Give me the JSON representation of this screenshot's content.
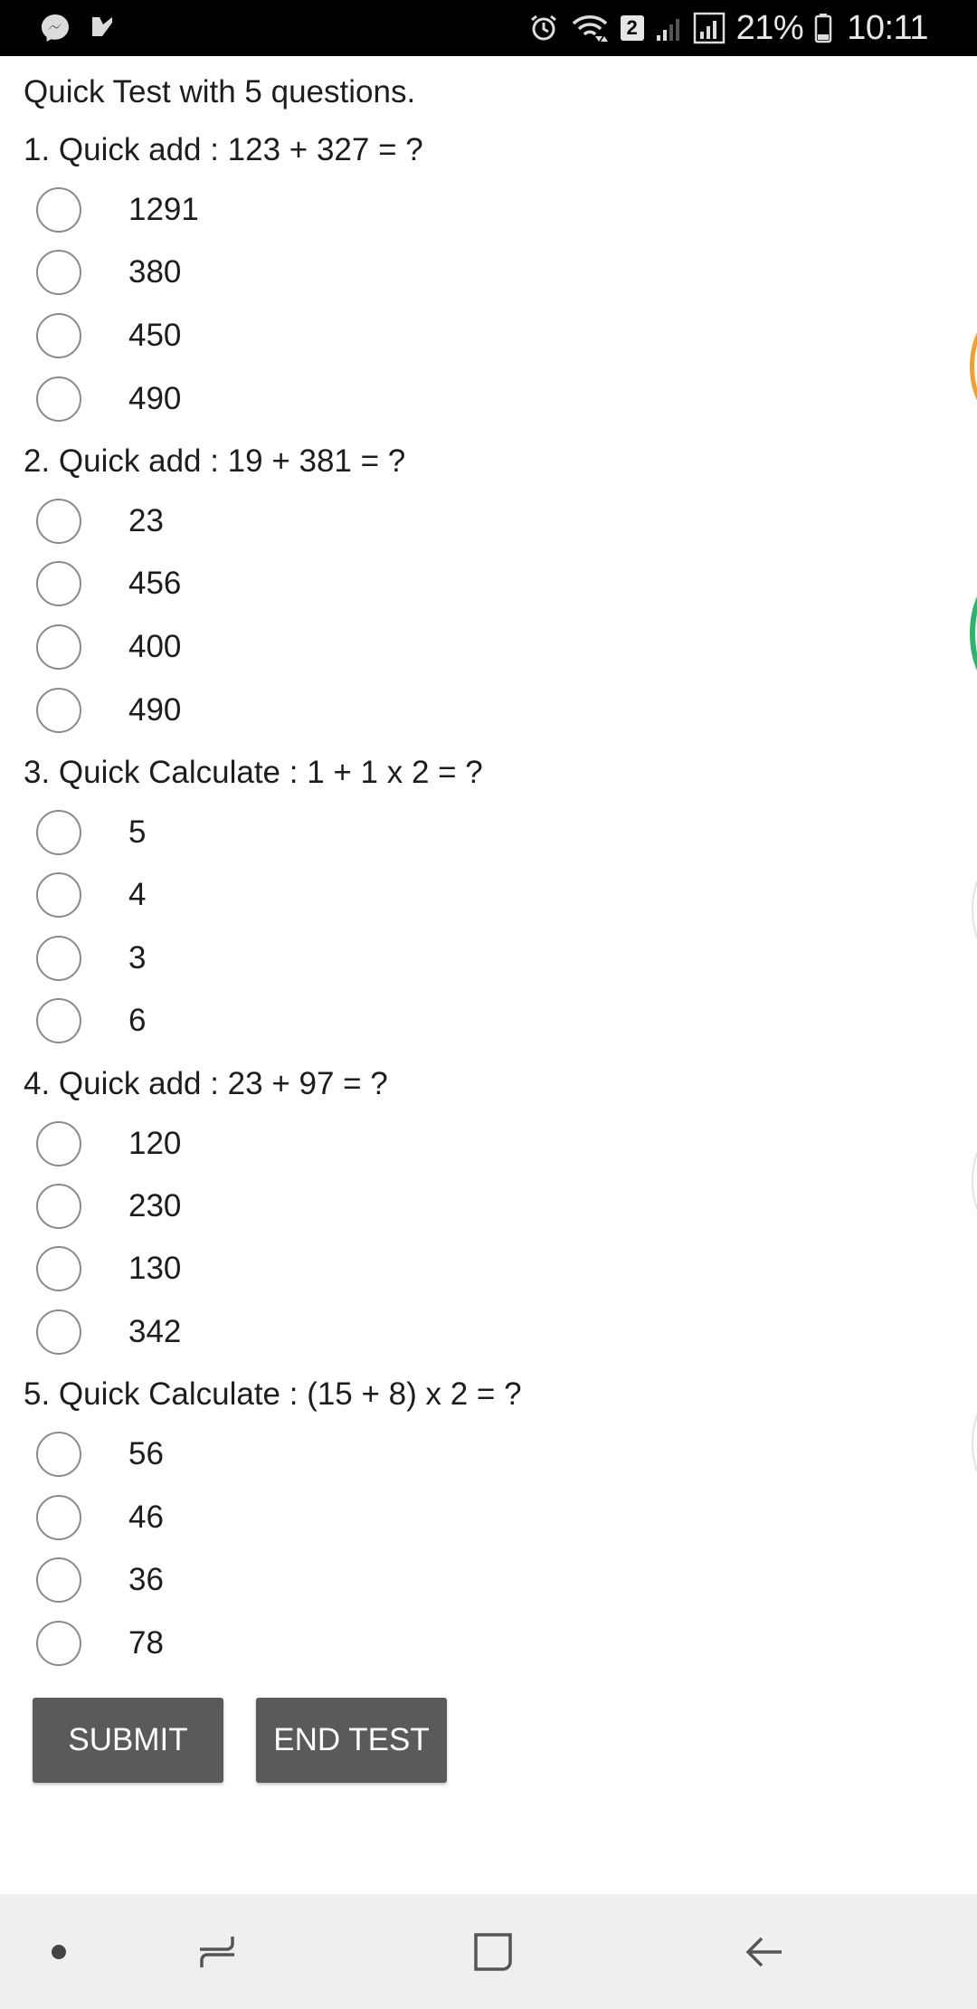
{
  "status_bar": {
    "left_icons": [
      "messenger-icon",
      "notification-check-icon"
    ],
    "right_icons": [
      "alarm-icon",
      "wifi-icon",
      "sim-2-icon",
      "signal-weak-icon",
      "signal-icon",
      "battery-icon"
    ],
    "sim_label": "2",
    "battery_percent": "21%",
    "time": "10:11"
  },
  "quiz": {
    "intro": "Quick Test with 5 questions.",
    "questions": [
      {
        "text": "1. Quick add : 123 + 327 = ?",
        "options": [
          "1291",
          "380",
          "450",
          "490"
        ]
      },
      {
        "text": "2. Quick add : 19 + 381 = ?",
        "options": [
          "23",
          "456",
          "400",
          "490"
        ]
      },
      {
        "text": "3. Quick Calculate : 1 + 1 x 2 = ?",
        "options": [
          "5",
          "4",
          "3",
          "6"
        ]
      },
      {
        "text": "4. Quick add : 23 + 97 = ?",
        "options": [
          "120",
          "230",
          "130",
          "342"
        ]
      },
      {
        "text": "5. Quick Calculate : (15 + 8) x 2 = ?",
        "options": [
          "56",
          "46",
          "36",
          "78"
        ]
      }
    ],
    "submit_label": "SUBMIT",
    "end_test_label": "END TEST"
  },
  "colors": {
    "button_bg": "#5a5a5a",
    "radio_border": "#8a8a8a",
    "edge_orange": "#f0a030",
    "edge_green": "#2db36a",
    "nav_bg": "#efefef"
  },
  "nav_bar": {
    "items": [
      "dot-icon",
      "recent-apps-icon",
      "home-icon",
      "back-icon"
    ]
  }
}
